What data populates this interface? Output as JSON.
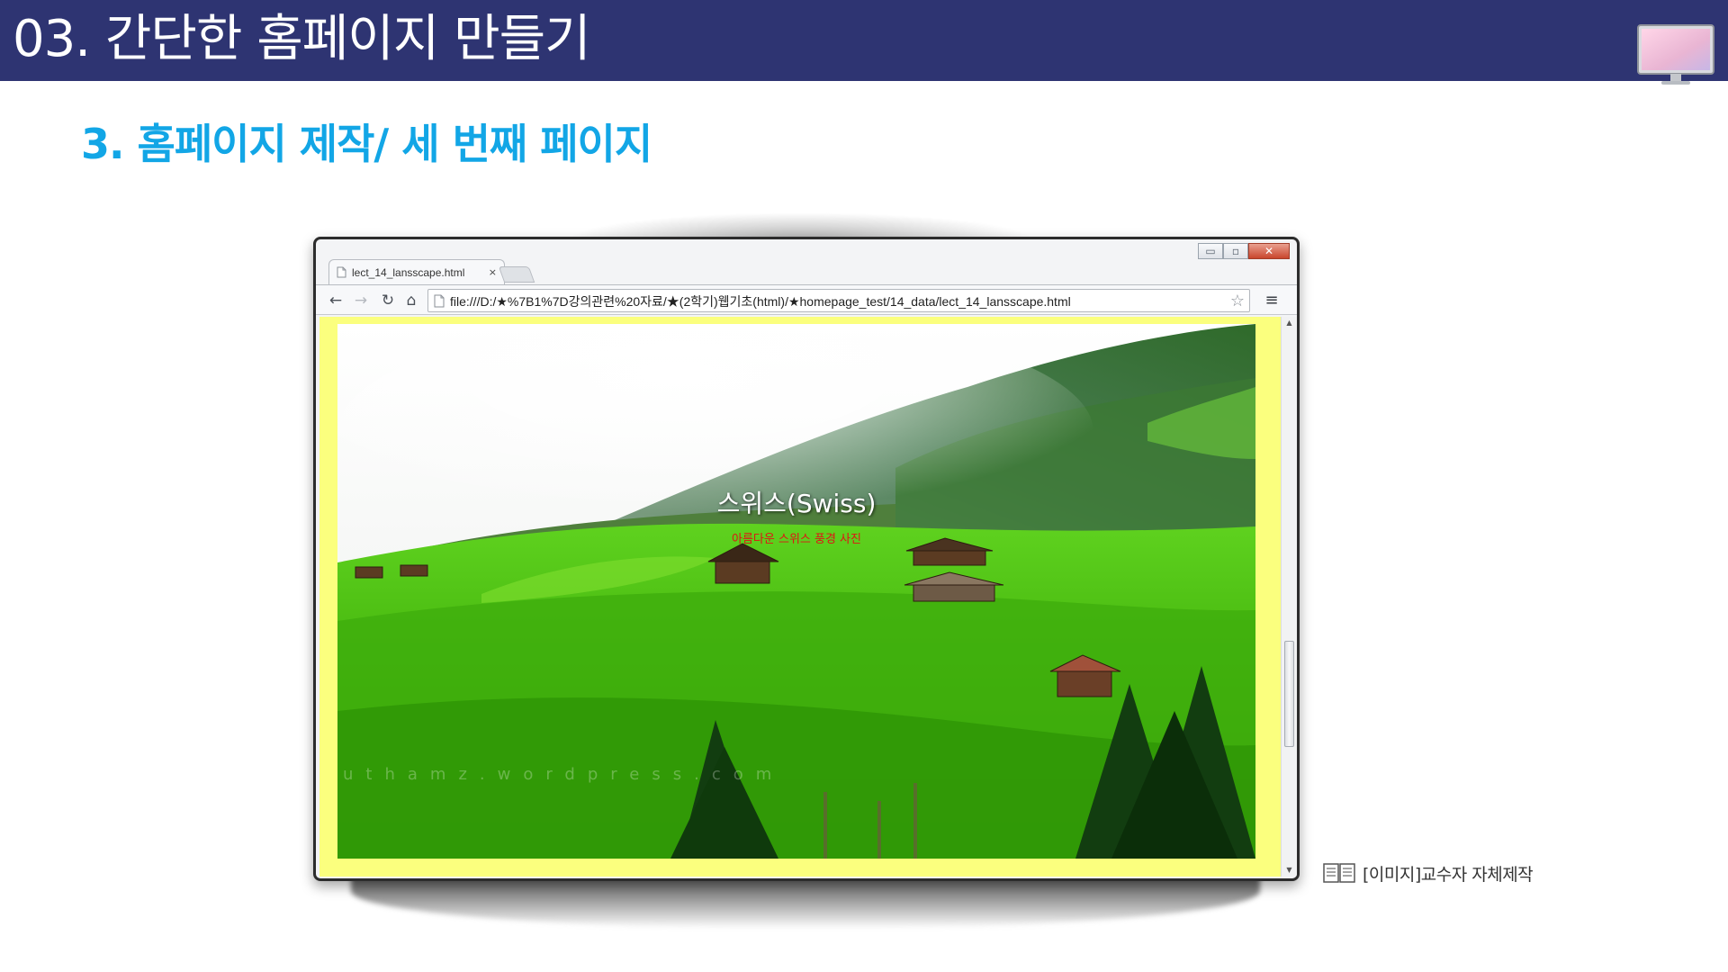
{
  "slide": {
    "header_title": "03. 간단한 홈페이지 만들기",
    "section_title": "3. 홈페이지 제작/ 세 번째 페이지",
    "header_color": "#2e3472",
    "accent_color": "#12a6e6",
    "header_icon": "monitor-icon"
  },
  "browser": {
    "tab_title": "lect_14_lansscape.html",
    "tab_close": "×",
    "url": "file:///D:/★%7B1%7D강의관련%20자료/★(2학기)웹기초(html)/★homepage_test/14_data/lect_14_lansscape.html",
    "window_controls": [
      "minimize-icon",
      "maximize-icon",
      "close-icon"
    ],
    "nav_icons": [
      "back-icon",
      "forward-icon",
      "reload-icon",
      "home-icon",
      "page-icon",
      "star-icon",
      "menu-icon"
    ],
    "forward_enabled": false,
    "page_background": "#fbff7e"
  },
  "page": {
    "heading": "스위스(Swiss)",
    "subtext": "아름다운 스위스 풍경 사진",
    "heading_color": "#ffffff",
    "subtext_color": "#e01414",
    "watermark": "uthamz.wordpress.com"
  },
  "caption": {
    "text": "[이미지]교수자 자체제작",
    "icon": "book-icon"
  }
}
